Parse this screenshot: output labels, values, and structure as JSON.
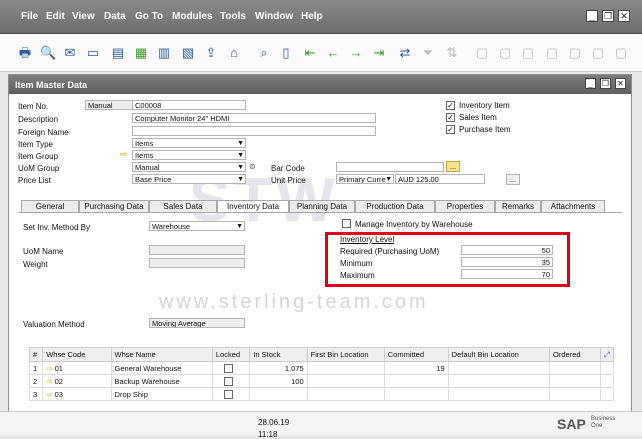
{
  "menubar": {
    "items": [
      "File",
      "Edit",
      "View",
      "Data",
      "Go To",
      "Modules",
      "Tools",
      "Window",
      "Help"
    ]
  },
  "window": {
    "title": "Item Master Data"
  },
  "header": {
    "item_no_label": "Item No.",
    "item_no_series": "Manual",
    "item_no_value": "C00008",
    "description_label": "Description",
    "description_value": "Computer Monitor 24\" HDMI",
    "foreign_name_label": "Foreign Name",
    "item_type_label": "Item Type",
    "item_type_value": "Items",
    "item_group_label": "Item Group",
    "item_group_value": "Items",
    "uom_group_label": "UoM Group",
    "uom_group_value": "Manual",
    "price_list_label": "Price List",
    "price_list_value": "Base Price",
    "bar_code_label": "Bar Code",
    "unit_price_label": "Unit Price",
    "unit_price_list": "Primary Curre",
    "unit_price_value": "AUD 125.00",
    "lookup_button": "...",
    "checkbox_inventory_item": "Inventory Item",
    "checkbox_sales_item": "Sales Item",
    "checkbox_purchase_item": "Purchase Item"
  },
  "tabs": [
    "General",
    "Purchasing Data",
    "Sales Data",
    "Inventory Data",
    "Planning Data",
    "Production Data",
    "Properties",
    "Remarks",
    "Attachments"
  ],
  "inventory": {
    "set_inv_method_label": "Set Inv. Method By",
    "set_inv_method_value": "Warehouse",
    "uom_name_label": "UoM Name",
    "weight_label": "Weight",
    "manage_by_wh_label": "Manage Inventory by Warehouse",
    "inventory_level_title": "Inventory Level",
    "required_label": "Required (Purchasing UoM)",
    "required_value": "50",
    "minimum_label": "Minimum",
    "minimum_value": "35",
    "maximum_label": "Maximum",
    "maximum_value": "70",
    "valuation_method_label": "Valuation Method",
    "valuation_method_value": "Moving Average"
  },
  "watermark": {
    "logo": "STW",
    "url": "www.sterling-team.com"
  },
  "grid": {
    "columns": [
      "#",
      "Whse Code",
      "Whse Name",
      "Locked",
      "In Stock",
      "First Bin Location",
      "Committed",
      "Default Bin Location",
      "Ordered"
    ],
    "rows": [
      {
        "num": "1",
        "code": "01",
        "name": "General Warehouse",
        "in_stock": "1,075",
        "committed": "19"
      },
      {
        "num": "2",
        "code": "02",
        "name": "Backup Warehouse",
        "in_stock": "100",
        "committed": ""
      },
      {
        "num": "3",
        "code": "03",
        "name": "Drop Ship",
        "in_stock": "",
        "committed": ""
      }
    ]
  },
  "statusbar": {
    "date": "28.06.19",
    "time": "11:18",
    "brand_main": "SAP",
    "brand_sub": "Business One"
  }
}
